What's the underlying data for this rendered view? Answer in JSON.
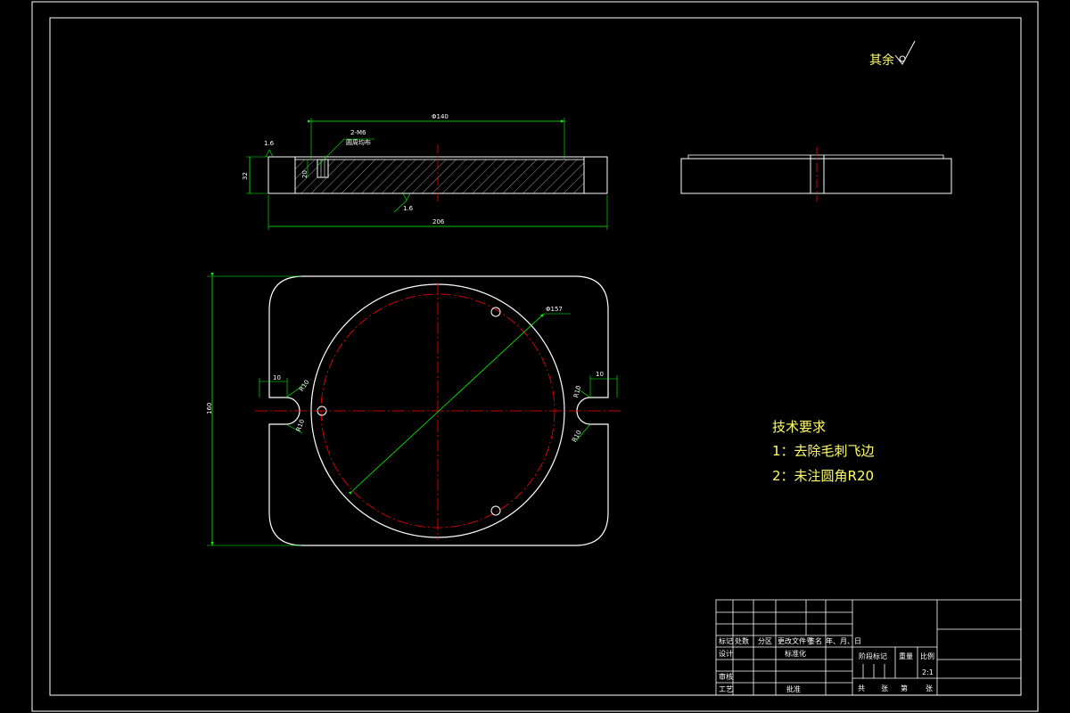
{
  "roughness": {
    "label": "其余"
  },
  "section_view": {
    "overall_width_dim": "206",
    "inner_length_dim": "Φ140",
    "height_dim": "32",
    "hole_depth_dim": "20",
    "hole_note_line1": "2-M6",
    "hole_note_line2": "圆周均布",
    "finish_top": "1.6",
    "finish_bottom": "1.6"
  },
  "plan_view": {
    "height_dim": "160",
    "circle_dim": "Φ157",
    "slot_width_left": "10",
    "slot_width_right": "10",
    "radius_left_top": "R10",
    "radius_left_bottom": "R10",
    "radius_right_top": "R10",
    "radius_right_bottom": "R10"
  },
  "tech_requirements": {
    "title": "技术要求",
    "item1": "1：去除毛刺飞边",
    "item2": "2：未注圆角R20"
  },
  "title_block": {
    "marks": "标记",
    "count": "处数",
    "zone": "分区",
    "change_doc": "更改文件号",
    "signature": "签名",
    "date": "年、月、日",
    "design": "设计",
    "standardize": "标准化",
    "review": "审核",
    "process": "工艺",
    "approve": "批准",
    "stage_mark": "阶段标记",
    "weight": "重量",
    "scale_label": "比例",
    "scale_value": "2:1",
    "sheet_total": "共",
    "sheet_total_unit": "张",
    "sheet_no": "第",
    "sheet_no_unit": "张"
  },
  "colors": {
    "background": "#000000",
    "outline": "#ffffff",
    "dimension": "#00ff00",
    "center": "#ff0000",
    "text_cjk": "#ffff66"
  }
}
